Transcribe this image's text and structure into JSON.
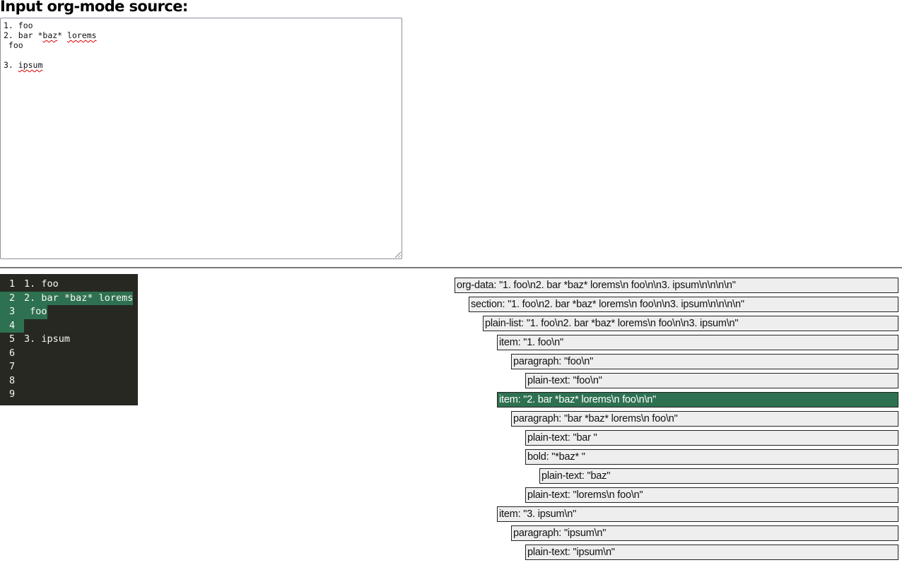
{
  "header": {
    "title": "Input org-mode source:"
  },
  "source": {
    "lines": [
      [
        {
          "t": "1. foo"
        }
      ],
      [
        {
          "t": "2. bar *"
        },
        {
          "t": "baz",
          "misspelled": true
        },
        {
          "t": "* "
        },
        {
          "t": "lorems",
          "misspelled": true
        }
      ],
      [
        {
          "t": " foo"
        }
      ],
      [
        {
          "t": ""
        }
      ],
      [
        {
          "t": "3. "
        },
        {
          "t": "ipsum",
          "misspelled": true
        }
      ]
    ]
  },
  "code_view": {
    "highlight_color": "#2e7150",
    "lines": [
      {
        "num": "1",
        "text": "1. foo",
        "highlighted": false
      },
      {
        "num": "2",
        "text": "2. bar *baz* lorems",
        "highlighted": true
      },
      {
        "num": "3",
        "text": " foo",
        "highlighted": true
      },
      {
        "num": "4",
        "text": "",
        "highlighted": true
      },
      {
        "num": "5",
        "text": "3. ipsum",
        "highlighted": false
      },
      {
        "num": "6",
        "text": "",
        "highlighted": false
      },
      {
        "num": "7",
        "text": "",
        "highlighted": false
      },
      {
        "num": "8",
        "text": "",
        "highlighted": false
      },
      {
        "num": "9",
        "text": "",
        "highlighted": false
      }
    ]
  },
  "tree": {
    "nodes": [
      {
        "depth": 0,
        "label": "org-data: \"1. foo\\n2. bar *baz* lorems\\n foo\\n\\n3. ipsum\\n\\n\\n\\n\"",
        "selected": false
      },
      {
        "depth": 1,
        "label": "section: \"1. foo\\n2. bar *baz* lorems\\n foo\\n\\n3. ipsum\\n\\n\\n\\n\"",
        "selected": false
      },
      {
        "depth": 2,
        "label": "plain-list: \"1. foo\\n2. bar *baz* lorems\\n foo\\n\\n3. ipsum\\n\"",
        "selected": false
      },
      {
        "depth": 3,
        "label": "item: \"1. foo\\n\"",
        "selected": false
      },
      {
        "depth": 4,
        "label": "paragraph: \"foo\\n\"",
        "selected": false
      },
      {
        "depth": 5,
        "label": "plain-text: \"foo\\n\"",
        "selected": false
      },
      {
        "depth": 3,
        "label": "item: \"2. bar *baz* lorems\\n foo\\n\\n\"",
        "selected": true
      },
      {
        "depth": 4,
        "label": "paragraph: \"bar *baz* lorems\\n foo\\n\"",
        "selected": false
      },
      {
        "depth": 5,
        "label": "plain-text: \"bar \"",
        "selected": false
      },
      {
        "depth": 5,
        "label": "bold: \"*baz* \"",
        "selected": false
      },
      {
        "depth": 6,
        "label": "plain-text: \"baz\"",
        "selected": false
      },
      {
        "depth": 5,
        "label": "plain-text: \"lorems\\n foo\\n\"",
        "selected": false
      },
      {
        "depth": 3,
        "label": "item: \"3. ipsum\\n\"",
        "selected": false
      },
      {
        "depth": 4,
        "label": "paragraph: \"ipsum\\n\"",
        "selected": false
      },
      {
        "depth": 5,
        "label": "plain-text: \"ipsum\\n\"",
        "selected": false
      }
    ]
  }
}
